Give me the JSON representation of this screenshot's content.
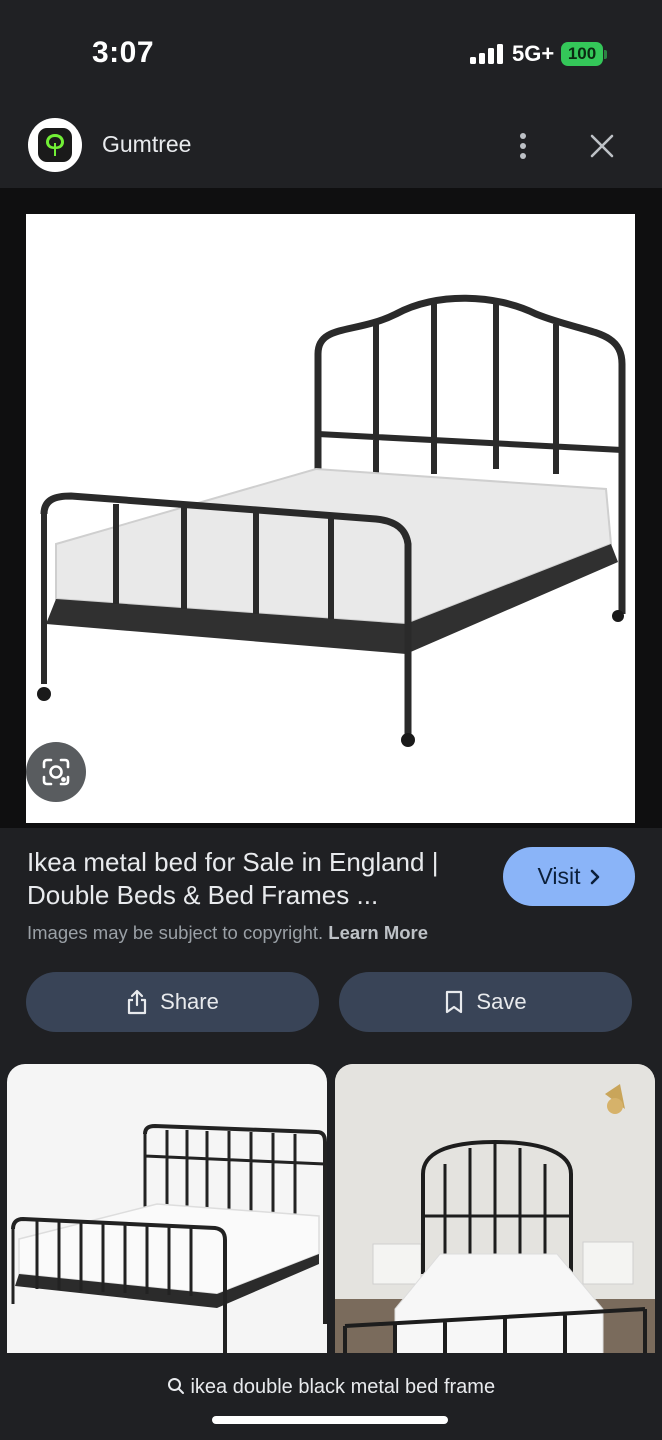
{
  "status": {
    "time": "3:07",
    "network": "5G+",
    "battery": "100"
  },
  "app": {
    "name": "Gumtree",
    "logo_icon": "tree-icon"
  },
  "result": {
    "title": "Ikea metal bed for Sale in England | Double Beds & Bed Frames ...",
    "visit_label": "Visit",
    "copyright_text": "Images may be subject to copyright.",
    "learn_more": "Learn More"
  },
  "actions": {
    "share_label": "Share",
    "save_label": "Save"
  },
  "search": {
    "query": "ikea double black metal bed frame"
  },
  "colors": {
    "accent": "#8ab4f8",
    "pill": "#394457",
    "background": "#1f2023",
    "gumtree_green": "#72ef36"
  }
}
